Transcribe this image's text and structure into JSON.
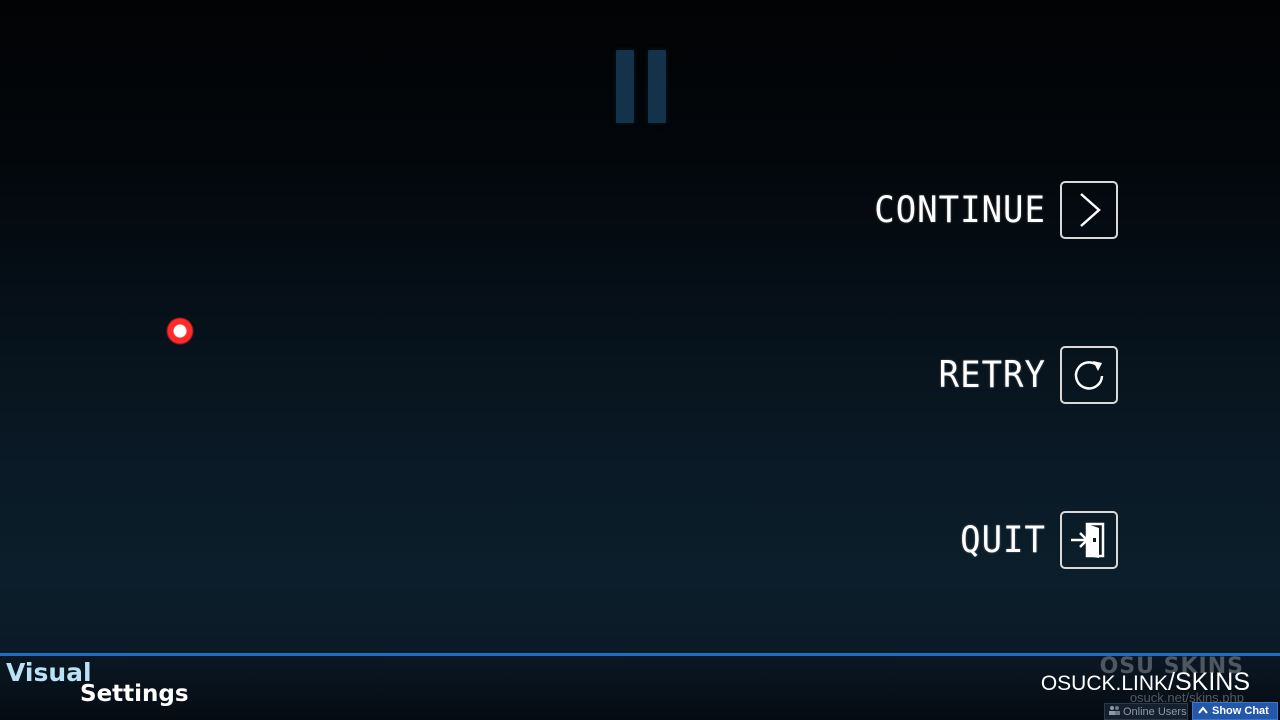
{
  "pause_menu": {
    "items": [
      {
        "label": "CONTINUE",
        "icon": "arrow-right-icon"
      },
      {
        "label": "RETRY",
        "icon": "retry-icon"
      },
      {
        "label": "QUIT",
        "icon": "exit-icon"
      }
    ],
    "pause_icon": "pause-icon"
  },
  "cursor": {
    "icon": "cursor-icon",
    "color": "#ff2a2a"
  },
  "footer": {
    "visual_label": "Visual",
    "settings_label": "Settings",
    "brand_faint": "OSU SKINS",
    "brand_link_main": "OSUCK.LINK",
    "brand_link_sep": "/",
    "brand_link_suffix": "SKINS",
    "brand_sub": "osuck.net/skins.php",
    "online_users_label": "Online Users",
    "show_chat_label": "Show Chat",
    "accent_color": "#1a6fc4"
  }
}
